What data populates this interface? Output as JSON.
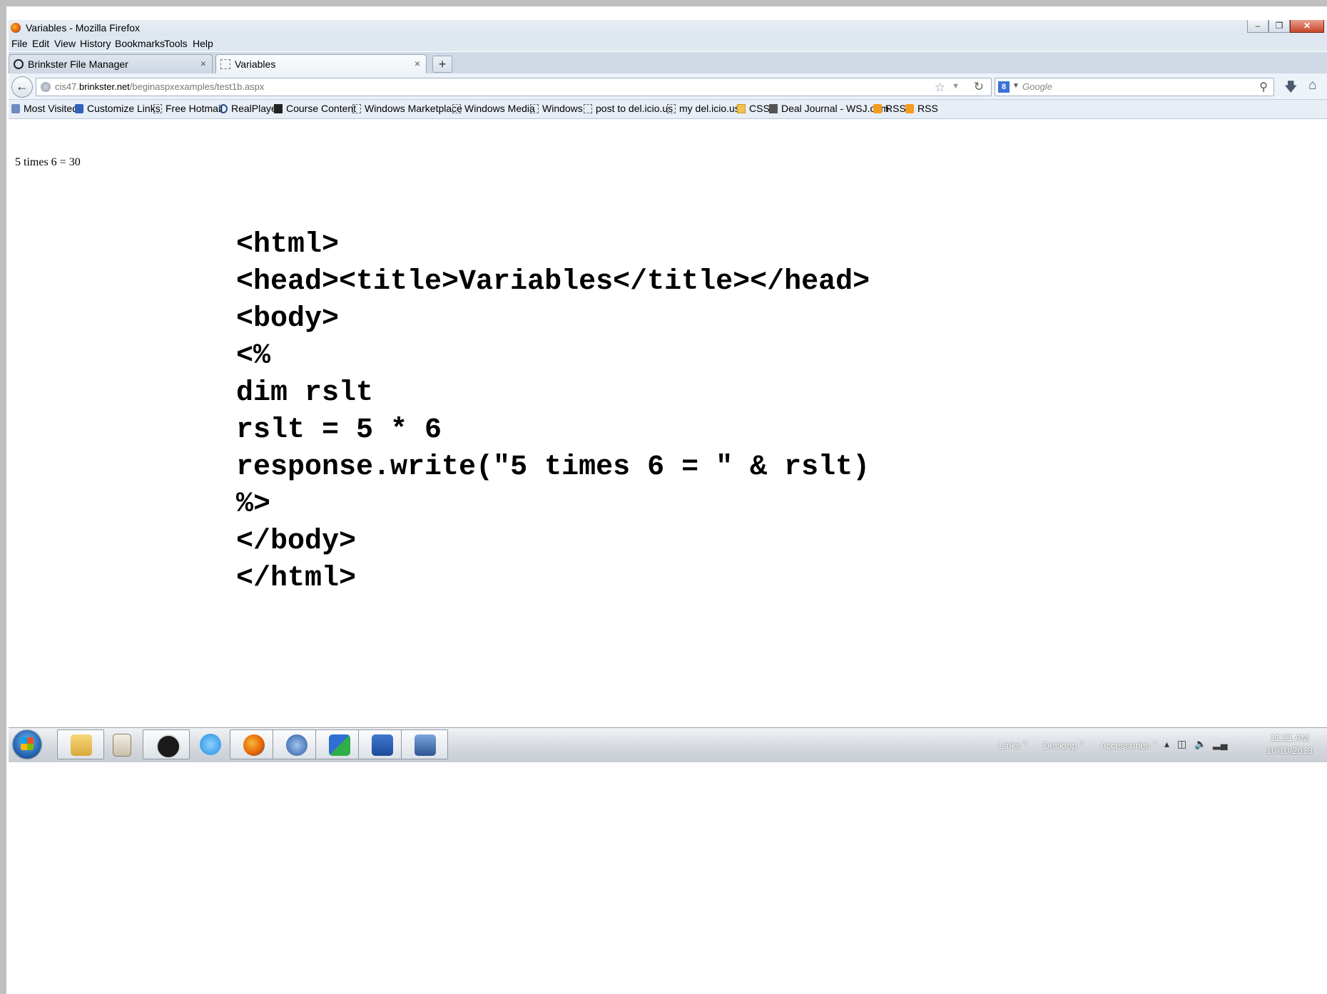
{
  "window": {
    "title": "Variables - Mozilla Firefox",
    "controls": {
      "minimize": "–",
      "restore": "❐",
      "close": "✕"
    }
  },
  "menu": [
    "File",
    "Edit",
    "View",
    "History",
    "Bookmarks",
    "Tools",
    "Help"
  ],
  "tabs": [
    {
      "label": "Brinkster File Manager",
      "close": "×",
      "icon": "brinkster-icon"
    },
    {
      "label": "Variables",
      "close": "×",
      "icon": "blank-page-icon"
    }
  ],
  "new_tab": "+",
  "navigation": {
    "url_prefix": "cis47.",
    "url_domain": "brinkster.net",
    "url_path": "/beginaspxexamples/test1b.aspx",
    "search_placeholder": "Google",
    "search_engine_letter": "8"
  },
  "bookmarks": [
    {
      "label": "Most Visited",
      "icon": "most-visited-icon"
    },
    {
      "label": "Customize Links",
      "icon": "msn-icon"
    },
    {
      "label": "Free Hotmail",
      "icon": "page-icon"
    },
    {
      "label": "RealPlayer",
      "icon": "realplayer-icon"
    },
    {
      "label": "Course Content",
      "icon": "course-icon"
    },
    {
      "label": "Windows Marketplace",
      "icon": "page-icon"
    },
    {
      "label": "Windows Media",
      "icon": "page-icon"
    },
    {
      "label": "Windows",
      "icon": "page-icon"
    },
    {
      "label": "post to del.icio.us",
      "icon": "page-icon"
    },
    {
      "label": "my del.icio.us",
      "icon": "page-icon"
    },
    {
      "label": "CSS",
      "icon": "folder-icon"
    },
    {
      "label": "Deal Journal - WSJ.com",
      "icon": "wsj-icon"
    },
    {
      "label": "RSS",
      "icon": "rss-icon"
    },
    {
      "label": "RSS",
      "icon": "rss-icon"
    }
  ],
  "page": {
    "output": "5 times 6 = 30"
  },
  "code_lines": [
    "<html>",
    "<head><title>Variables</title></head>",
    "<body>",
    "<%",
    "dim rslt",
    "rslt = 5 * 6",
    "response.write(\"5 times 6 = \" & rslt)",
    "%>",
    "</body>",
    "</html>"
  ],
  "taskbar": {
    "apps": [
      "windows-explorer",
      "mahjong",
      "hp",
      "internet-explorer",
      "firefox",
      "thunderbird",
      "network-tool",
      "word",
      "screen-capture"
    ],
    "toolbars": [
      "Links",
      "Desktop",
      "Accessories"
    ],
    "time": "11:21 AM",
    "date": "10/10/2013"
  },
  "colors": {
    "chrome_bg": "#dfe7f1",
    "taskbar_bg": "#d4d8de",
    "close_button": "#c9452a"
  }
}
